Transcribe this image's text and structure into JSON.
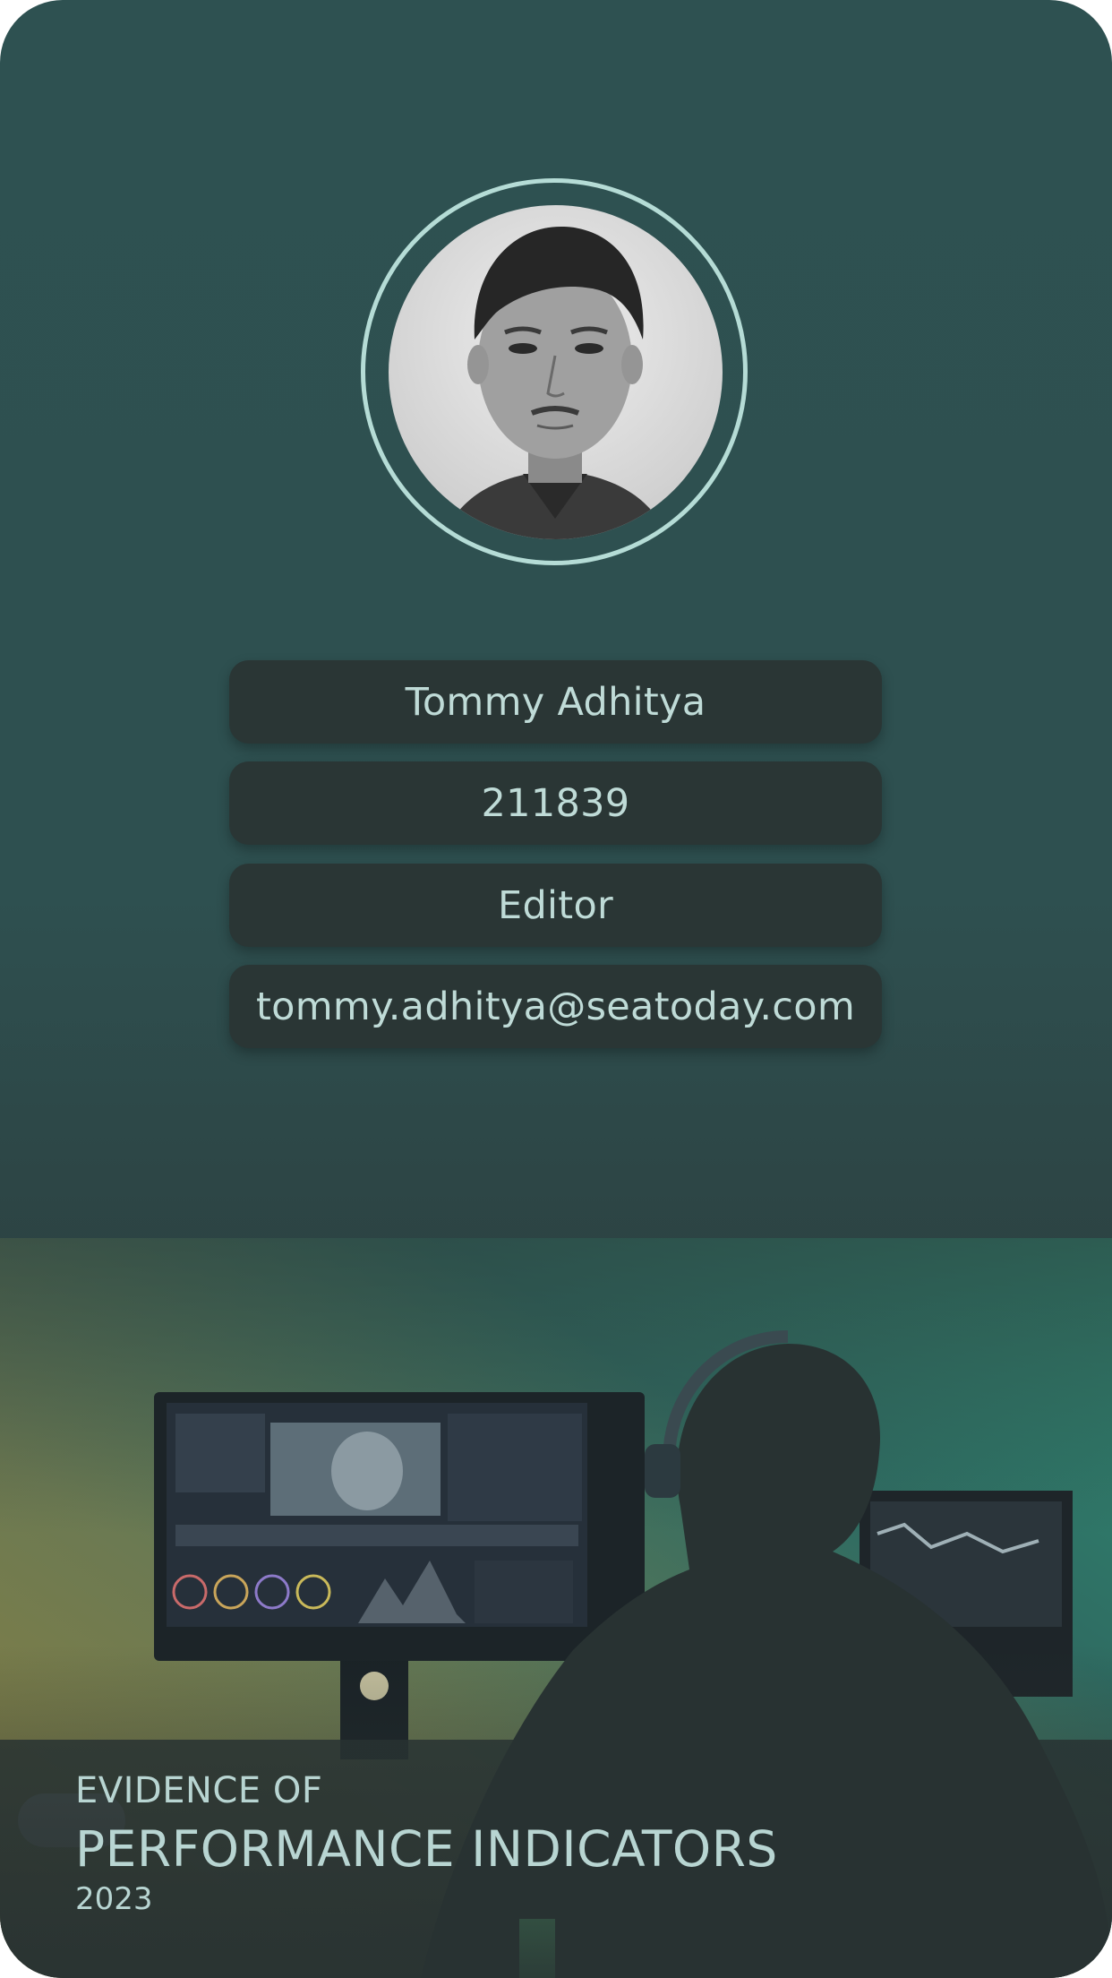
{
  "profile": {
    "photo": "avatar-photo",
    "name": "Tommy Adhitya",
    "id_number": "211839",
    "role": "Editor",
    "email": "tommy.adhitya@seatoday.com"
  },
  "banner": {
    "image": "editing-workstation-photo",
    "line1": "EVIDENCE OF",
    "line2": "PERFORMANCE INDICATORS",
    "year": "2023"
  },
  "colors": {
    "card_top": "#2e5151",
    "card_bottom": "#2b3737",
    "field_bg": "#2a3635",
    "text": "#bfdbd7",
    "ring": "#b5dcd6"
  }
}
